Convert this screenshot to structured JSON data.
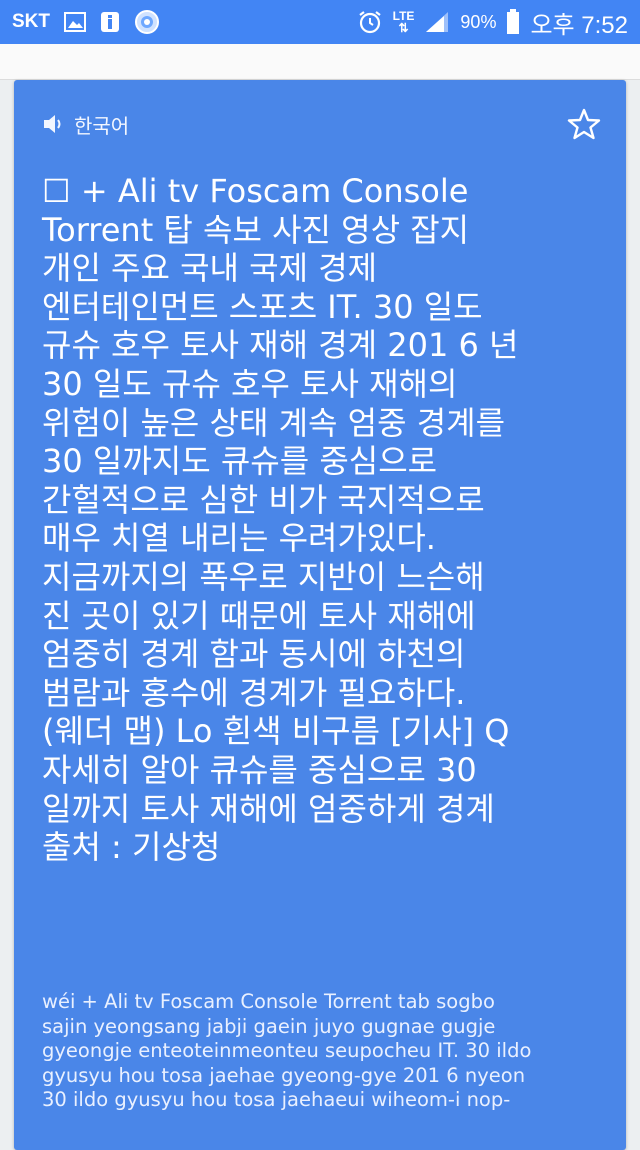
{
  "status_bar": {
    "carrier": "SKT",
    "network": "LTE",
    "battery": "90%",
    "time": "오후 7:52",
    "icons": [
      "image-icon",
      "info-icon",
      "app-icon",
      "alarm-icon",
      "signal-icon",
      "battery-icon"
    ]
  },
  "card": {
    "language": "한국어",
    "speaker_icon": "volume-icon",
    "star_icon": "star-outline-icon",
    "source_text": "☐ + Ali tv Foscam Console\nTorrent 탑 속보 사진 영상 잡지\n개인 주요 국내 국제 경제\n엔터테인먼트 스포츠 IT. 30 일도\n규슈 호우 토사 재해 경계 201 6 년\n30 일도 규슈 호우 토사 재해의\n위험이 높은 상태 계속 엄중 경계를\n30 일까지도 큐슈를 중심으로\n간헐적으로 심한 비가 국지적으로\n매우 치열 내리는 우려가있다.\n지금까지의 폭우로 지반이 느슨해\n진 곳이 있기 때문에 토사 재해에\n엄중히 경계 함과 동시에 하천의\n범람과 홍수에 경계가 필요하다.\n(웨더 맵) Lo 흰색 비구름 [기사] Q\n자세히 알아 큐슈를 중심으로 30\n일까지 토사 재해에 엄중하게 경계\n출처 : 기상청",
    "romanization": "wéi + Ali tv Foscam Console Torrent tab sogbo\nsajin yeongsang jabji gaein juyo gugnae gugje\ngyeongje enteoteinmeonteu seupocheu IT. 30 ildo\ngyusyu hou tosa jaehae gyeong-gye 201 6 nyeon\n30 ildo gyusyu hou tosa jaehaeui wiheom-i nop-"
  },
  "colors": {
    "status_bar": "#4285f4",
    "card": "#4a86e8",
    "background": "#eceff1"
  }
}
